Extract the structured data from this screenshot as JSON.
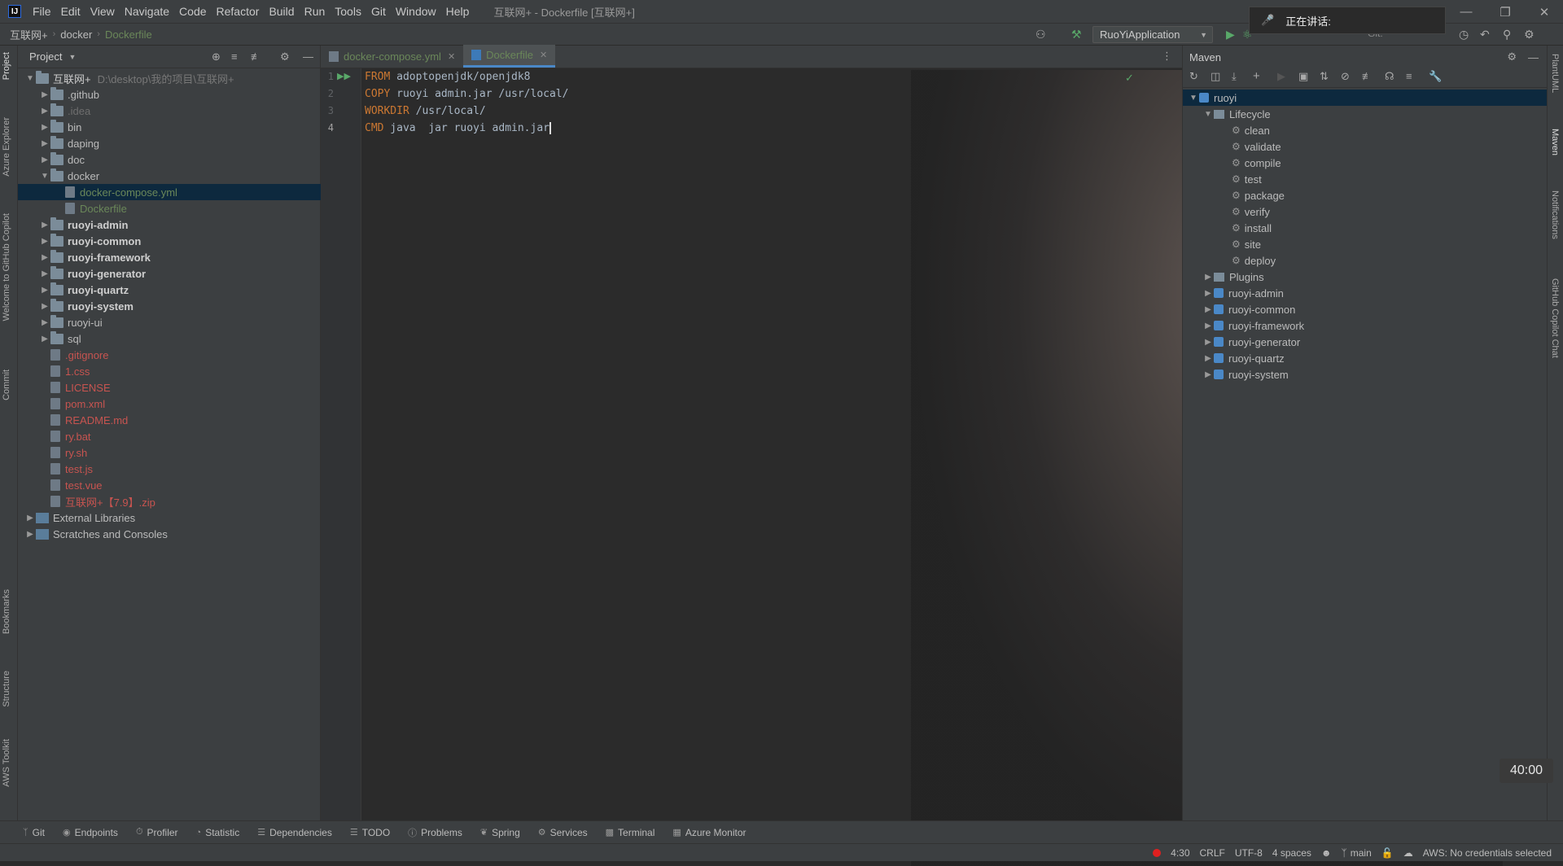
{
  "menu": {
    "items": [
      "File",
      "Edit",
      "View",
      "Navigate",
      "Code",
      "Refactor",
      "Build",
      "Run",
      "Tools",
      "Git",
      "Window",
      "Help"
    ],
    "window_title": "互联网+ - Dockerfile [互联网+]"
  },
  "breadcrumb": [
    "互联网+",
    "docker",
    "Dockerfile"
  ],
  "run_config": "RuoYiApplication",
  "git_label": "Git:",
  "talk_banner": "正在讲话:",
  "project_panel": {
    "title": "Project",
    "root": {
      "name": "互联网+",
      "path": "D:\\desktop\\我的项目\\互联网+"
    },
    "items": [
      {
        "label": ".github",
        "type": "folder",
        "indent": 1,
        "expanded": false,
        "color": "#bbbbbb"
      },
      {
        "label": ".idea",
        "type": "folder",
        "indent": 1,
        "expanded": false,
        "color": "#6e6e6e"
      },
      {
        "label": "bin",
        "type": "folder",
        "indent": 1,
        "expanded": false,
        "color": "#bbbbbb"
      },
      {
        "label": "daping",
        "type": "folder",
        "indent": 1,
        "expanded": false,
        "color": "#bbbbbb"
      },
      {
        "label": "doc",
        "type": "folder",
        "indent": 1,
        "expanded": false,
        "color": "#bbbbbb"
      },
      {
        "label": "docker",
        "type": "folder",
        "indent": 1,
        "expanded": true,
        "color": "#bbbbbb"
      },
      {
        "label": "docker-compose.yml",
        "type": "file",
        "indent": 2,
        "color": "#6a8759",
        "selected": true
      },
      {
        "label": "Dockerfile",
        "type": "file",
        "indent": 2,
        "color": "#6a8759"
      },
      {
        "label": "ruoyi-admin",
        "type": "module",
        "indent": 1,
        "expanded": false,
        "color": "#cfcfcf"
      },
      {
        "label": "ruoyi-common",
        "type": "module",
        "indent": 1,
        "expanded": false,
        "color": "#cfcfcf"
      },
      {
        "label": "ruoyi-framework",
        "type": "module",
        "indent": 1,
        "expanded": false,
        "color": "#cfcfcf"
      },
      {
        "label": "ruoyi-generator",
        "type": "module",
        "indent": 1,
        "expanded": false,
        "color": "#cfcfcf"
      },
      {
        "label": "ruoyi-quartz",
        "type": "module",
        "indent": 1,
        "expanded": false,
        "color": "#cfcfcf"
      },
      {
        "label": "ruoyi-system",
        "type": "module",
        "indent": 1,
        "expanded": false,
        "color": "#cfcfcf"
      },
      {
        "label": "ruoyi-ui",
        "type": "folder",
        "indent": 1,
        "expanded": false,
        "color": "#bbbbbb"
      },
      {
        "label": "sql",
        "type": "folder",
        "indent": 1,
        "expanded": false,
        "color": "#bbbbbb"
      },
      {
        "label": ".gitignore",
        "type": "file",
        "indent": 1,
        "color": "#c75450"
      },
      {
        "label": "1.css",
        "type": "file",
        "indent": 1,
        "color": "#c75450"
      },
      {
        "label": "LICENSE",
        "type": "file",
        "indent": 1,
        "color": "#c75450"
      },
      {
        "label": "pom.xml",
        "type": "file",
        "indent": 1,
        "color": "#c75450"
      },
      {
        "label": "README.md",
        "type": "file",
        "indent": 1,
        "color": "#c75450"
      },
      {
        "label": "ry.bat",
        "type": "file",
        "indent": 1,
        "color": "#c75450"
      },
      {
        "label": "ry.sh",
        "type": "file",
        "indent": 1,
        "color": "#c75450"
      },
      {
        "label": "test.js",
        "type": "file",
        "indent": 1,
        "color": "#c75450"
      },
      {
        "label": "test.vue",
        "type": "file",
        "indent": 1,
        "color": "#c75450"
      },
      {
        "label": "互联网+【7.9】.zip",
        "type": "file",
        "indent": 1,
        "color": "#c75450"
      },
      {
        "label": "External Libraries",
        "type": "lib",
        "indent": 0,
        "expanded": false,
        "color": "#bbbbbb"
      },
      {
        "label": "Scratches and Consoles",
        "type": "lib",
        "indent": 0,
        "expanded": false,
        "color": "#bbbbbb"
      }
    ]
  },
  "left_tool_tabs": [
    "Project",
    "Azure Explorer",
    "Welcome to GitHub Copilot",
    "Commit",
    "Bookmarks",
    "Structure",
    "AWS Toolkit"
  ],
  "right_tool_tabs": [
    "PlantUML",
    "Maven",
    "Notifications",
    "GitHub Copilot Chat"
  ],
  "editor": {
    "tabs": [
      {
        "label": "docker-compose.yml",
        "active": false
      },
      {
        "label": "Dockerfile",
        "active": true
      }
    ],
    "lines": [
      {
        "num": "1",
        "kw": "FROM",
        "rest": " adoptopenjdk/openjdk8"
      },
      {
        "num": "2",
        "kw": "COPY",
        "rest": " ruoyi admin.jar /usr/local/"
      },
      {
        "num": "3",
        "kw": "WORKDIR",
        "rest": " /usr/local/"
      },
      {
        "num": "4",
        "kw": "CMD",
        "rest": " java  jar ruoyi admin.jar"
      }
    ]
  },
  "maven": {
    "title": "Maven",
    "root": "ruoyi",
    "lifecycle_label": "Lifecycle",
    "lifecycle": [
      "clean",
      "validate",
      "compile",
      "test",
      "package",
      "verify",
      "install",
      "site",
      "deploy"
    ],
    "plugins_label": "Plugins",
    "modules": [
      "ruoyi-admin",
      "ruoyi-common",
      "ruoyi-framework",
      "ruoyi-generator",
      "ruoyi-quartz",
      "ruoyi-system"
    ]
  },
  "bottom_tools": [
    "Git",
    "Endpoints",
    "Profiler",
    "Statistic",
    "Dependencies",
    "TODO",
    "Problems",
    "Spring",
    "Services",
    "Terminal",
    "Azure Monitor"
  ],
  "status": {
    "position": "4:30",
    "line_sep": "CRLF",
    "encoding": "UTF-8",
    "indent": "4 spaces",
    "branch": "main",
    "aws": "AWS: No credentials selected"
  },
  "timer": "40:00",
  "colors": {
    "accent": "#4a88c7",
    "unversioned": "#c75450",
    "added": "#6a8759",
    "selection": "#0d293e",
    "keyword": "#cc7832"
  }
}
